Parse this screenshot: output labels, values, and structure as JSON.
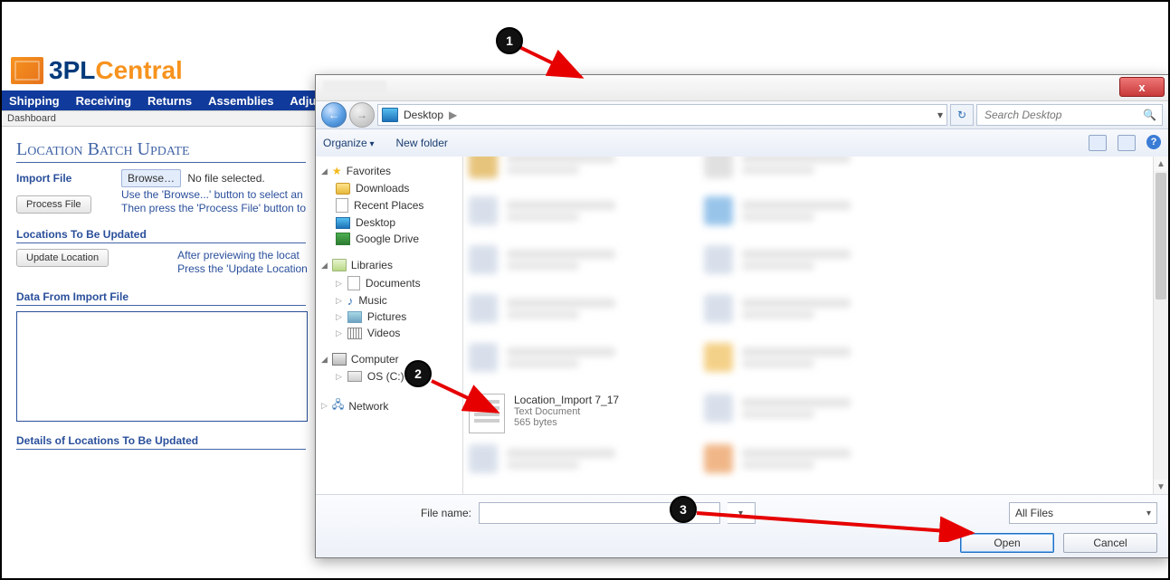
{
  "annotations": {
    "a1": "1",
    "a2": "2",
    "a3": "3"
  },
  "app": {
    "logo": {
      "part1": "3PL",
      "part2": "Central"
    },
    "nav": {
      "shipping": "Shipping",
      "receiving": "Receiving",
      "returns": "Returns",
      "assemblies": "Assemblies",
      "adj": "Adju"
    },
    "breadcrumb": "Dashboard",
    "pageTitle": "Location Batch Update",
    "importFile": {
      "label": "Import File",
      "browse": "Browse…",
      "status": "No file selected.",
      "hint1": "Use the 'Browse...' button to select an",
      "hint2": "Then press the 'Process File' button to"
    },
    "processFile": "Process File",
    "locations": {
      "label": "Locations To Be Updated",
      "hint1": "After previewing the locat",
      "hint2": "Press the 'Update Location"
    },
    "updateLocation": "Update Location",
    "dataFrom": "Data From Import File",
    "details": "Details of Locations To Be Updated"
  },
  "dialog": {
    "close": "x",
    "nav": {
      "crumb": "Desktop",
      "sep": "▶",
      "refresh": "↻",
      "searchPlaceholder": "Search Desktop",
      "searchIcon": "🔍"
    },
    "toolbar": {
      "organize": "Organize",
      "newFolder": "New folder",
      "help": "?"
    },
    "tree": {
      "favorites": "Favorites",
      "downloads": "Downloads",
      "recent": "Recent Places",
      "desktop": "Desktop",
      "gdrive": "Google Drive",
      "libraries": "Libraries",
      "documents": "Documents",
      "music": "Music",
      "pictures": "Pictures",
      "videos": "Videos",
      "computer": "Computer",
      "osc": "OS (C:)",
      "network": "Network"
    },
    "file": {
      "name": "Location_Import 7_17",
      "type": "Text Document",
      "size": "565 bytes"
    },
    "footer": {
      "fileNameLabel": "File name:",
      "filter": "All Files",
      "open": "Open",
      "cancel": "Cancel"
    }
  }
}
